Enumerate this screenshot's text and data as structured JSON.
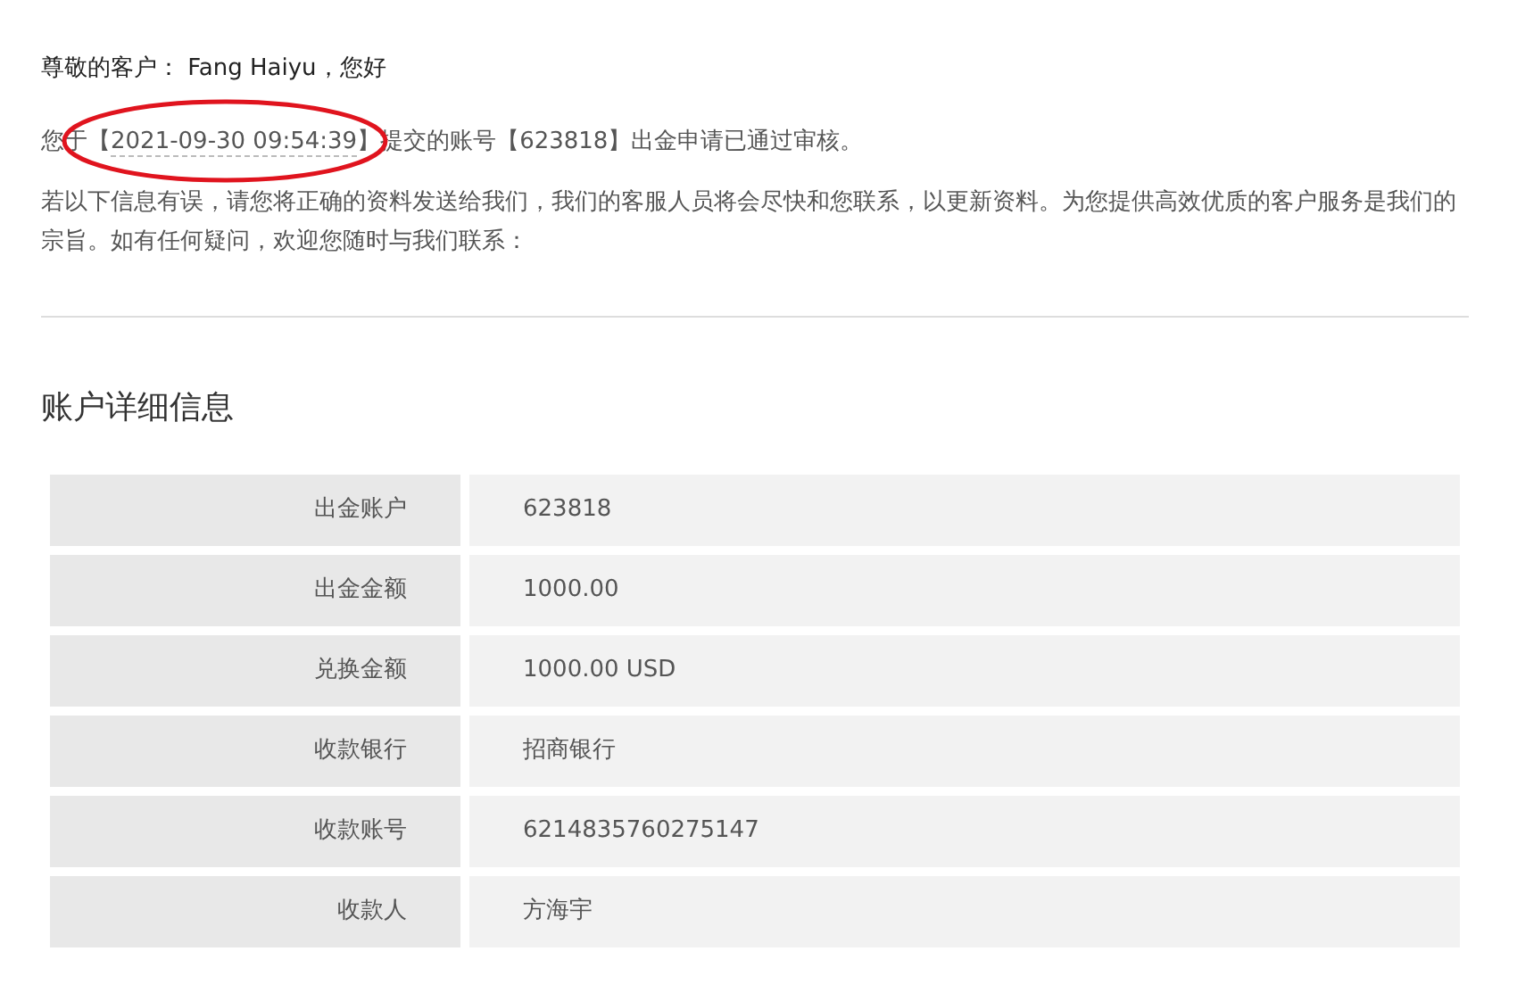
{
  "greeting": "尊敬的客户： Fang Haiyu，您好",
  "notice": {
    "before": "您于【",
    "date": "2021-09-30 09:54:39",
    "after": "】提交的账号【623818】出金申请已通过审核。"
  },
  "paragraph": "若以下信息有误，请您将正确的资料发送给我们，我们的客服人员将会尽快和您联系，以更新资料。为您提供高效优质的客户服务是我们的宗旨。如有任何疑问，欢迎您随时与我们联系：",
  "heading": "账户详细信息",
  "rows": [
    {
      "label": "出金账户",
      "value": "623818"
    },
    {
      "label": "出金金额",
      "value": "1000.00"
    },
    {
      "label": "兑换金额",
      "value": "1000.00 USD"
    },
    {
      "label": "收款银行",
      "value": "招商银行"
    },
    {
      "label": "收款账号",
      "value": "6214835760275147"
    },
    {
      "label": "收款人",
      "value": "方海宇"
    }
  ]
}
